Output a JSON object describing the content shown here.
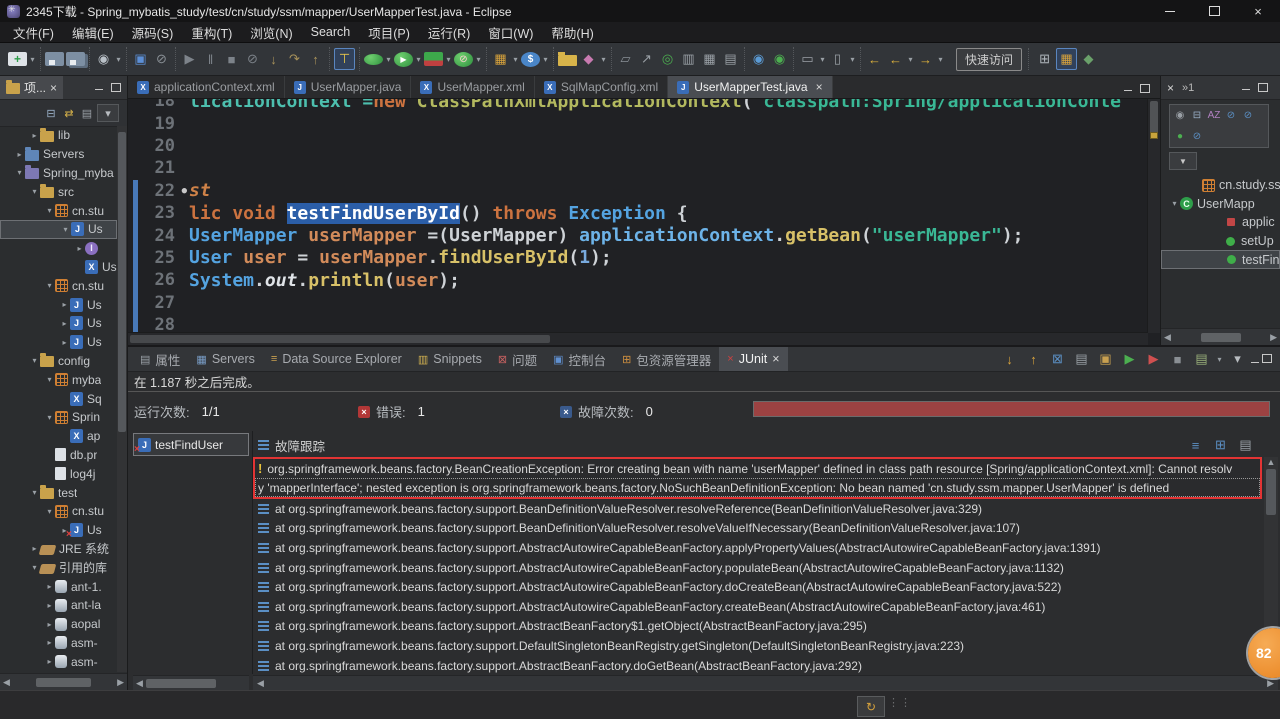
{
  "window": {
    "title": "2345下载 - Spring_mybatis_study/test/cn/study/ssm/mapper/UserMapperTest.java - Eclipse"
  },
  "menubar": [
    "文件(F)",
    "编辑(E)",
    "源码(S)",
    "重构(T)",
    "浏览(N)",
    "Search",
    "项目(P)",
    "运行(R)",
    "窗口(W)",
    "帮助(H)"
  ],
  "toolbar": {
    "quick_access_label": "快速访问",
    "groups": [
      [
        {
          "n": "new-wizard-icon",
          "k": "new",
          "dd": 1
        }
      ],
      [
        {
          "n": "save-icon",
          "k": "save"
        },
        {
          "n": "save-all-icon",
          "k": "saveall"
        }
      ],
      [
        {
          "n": "user-profile-icon",
          "g": "◉",
          "c": "#b9c0c7",
          "dd": 1
        }
      ],
      [
        {
          "n": "open-console-icon",
          "g": "▣",
          "c": "#5c8fd6"
        },
        {
          "n": "no-connection-icon",
          "g": "⊘",
          "c": "#8a9096"
        }
      ],
      [
        {
          "n": "resume-icon",
          "g": "▶",
          "c": "#7d838a"
        },
        {
          "n": "suspend-icon",
          "g": "‖",
          "c": "#7d838a"
        },
        {
          "n": "terminate-icon",
          "g": "■",
          "c": "#7d838a"
        },
        {
          "n": "disconnect-icon",
          "g": "⊘",
          "c": "#7d838a"
        },
        {
          "n": "step-into-icon",
          "g": "↓",
          "c": "#a8925a"
        },
        {
          "n": "step-over-icon",
          "g": "↷",
          "c": "#a8925a"
        },
        {
          "n": "step-return-icon",
          "g": "↑",
          "c": "#a8925a"
        }
      ],
      [
        {
          "n": "run-junit-test-icon",
          "g": "⊤",
          "c": "#e8c84a",
          "hl": 1
        }
      ],
      [
        {
          "n": "run-last-icon",
          "k": "rundot",
          "dd": 1
        },
        {
          "n": "run-icon",
          "k": "run",
          "dd": 1
        },
        {
          "n": "coverage-icon",
          "k": "cov",
          "dd": 1
        },
        {
          "n": "run-external-icon",
          "k": "runx",
          "dd": 1
        }
      ],
      [
        {
          "n": "new-javaee-icon",
          "g": "▦",
          "c": "#d8a33c",
          "dd": 1
        },
        {
          "n": "currency-tool-icon",
          "k": "dollar",
          "dd": 1
        }
      ],
      [
        {
          "n": "open-folder-icon",
          "k": "ofolder"
        },
        {
          "n": "paintbrush-icon",
          "g": "◆",
          "c": "#c87ab0",
          "dd": 1
        }
      ],
      [
        {
          "n": "flag-icon",
          "g": "▱",
          "c": "#8a9096"
        },
        {
          "n": "skew-arrow-icon",
          "g": "↗",
          "c": "#9aa0a6"
        },
        {
          "n": "new-class-icon",
          "g": "◎",
          "c": "#4CAF50"
        },
        {
          "n": "javadoc-icon",
          "g": "▥",
          "c": "#9aa0a6"
        },
        {
          "n": "table-icon",
          "g": "▦",
          "c": "#9aa0a6"
        },
        {
          "n": "grid-icon",
          "g": "▤",
          "c": "#9aa0a6"
        }
      ],
      [
        {
          "n": "web-browser-icon",
          "g": "◉",
          "c": "#5b9bd5"
        },
        {
          "n": "debug-browser-icon",
          "g": "◉",
          "c": "#4CAF50"
        }
      ],
      [
        {
          "n": "annotation-icon",
          "g": "▭",
          "c": "#9aa0a6",
          "dd": 1
        },
        {
          "n": "pin-icon",
          "g": "▯",
          "c": "#9aa0a6",
          "dd": 1
        }
      ],
      [
        {
          "n": "back-icon",
          "g": "←",
          "c": "#e0b43c"
        },
        {
          "n": "back-history-icon",
          "g": "←",
          "c": "#e0b43c",
          "dd": 1
        },
        {
          "n": "forward-icon",
          "g": "→",
          "c": "#e0b43c",
          "dd": 1
        }
      ]
    ],
    "perspectives": [
      {
        "n": "open-perspective-icon",
        "g": "⊞",
        "c": "#b0b6bc"
      },
      {
        "n": "javaee-perspective-icon",
        "g": "▦",
        "c": "#d8a33c",
        "hl": 1
      },
      {
        "n": "debug-perspective-icon",
        "g": "◆",
        "c": "#6aa06a"
      }
    ]
  },
  "explorer": {
    "tab_label": "项...",
    "toolbar": [
      {
        "n": "collapse-all-icon",
        "g": "⊟",
        "c": "#9ab0c8"
      },
      {
        "n": "link-with-editor-icon",
        "g": "⇄",
        "c": "#d8b44a"
      },
      {
        "n": "filters-icon",
        "g": "▤",
        "c": "#9aa0a6"
      },
      {
        "n": "view-menu-icon",
        "g": "▾",
        "c": "#b8bcc0",
        "box": 1
      }
    ],
    "tree": [
      {
        "lvl": 2,
        "arr": "c",
        "icon": "folder",
        "label": "lib"
      },
      {
        "lvl": 1,
        "arr": "c",
        "icon": "sfolder",
        "label": "Servers"
      },
      {
        "lvl": 1,
        "arr": "e",
        "icon": "project",
        "label": "Spring_myba"
      },
      {
        "lvl": 2,
        "arr": "e",
        "icon": "folder",
        "label": "src"
      },
      {
        "lvl": 3,
        "arr": "e",
        "icon": "pkg",
        "label": "cn.stu"
      },
      {
        "lvl": 4,
        "arr": "e",
        "icon": "java",
        "label": "Us",
        "sel": true
      },
      {
        "lvl": 5,
        "arr": "c",
        "icon": "iface",
        "label": ""
      },
      {
        "lvl": 5,
        "arr": null,
        "icon": "xml",
        "label": "Us"
      },
      {
        "lvl": 3,
        "arr": "e",
        "icon": "pkg",
        "label": "cn.stu"
      },
      {
        "lvl": 4,
        "arr": "c",
        "icon": "java",
        "label": "Us"
      },
      {
        "lvl": 4,
        "arr": "c",
        "icon": "java",
        "label": "Us"
      },
      {
        "lvl": 4,
        "arr": "c",
        "icon": "java",
        "label": "Us"
      },
      {
        "lvl": 2,
        "arr": "e",
        "icon": "folder",
        "label": "config"
      },
      {
        "lvl": 3,
        "arr": "e",
        "icon": "pkg",
        "label": "myba"
      },
      {
        "lvl": 4,
        "arr": null,
        "icon": "xml",
        "label": "Sq"
      },
      {
        "lvl": 3,
        "arr": "e",
        "icon": "pkg",
        "label": "Sprin"
      },
      {
        "lvl": 4,
        "arr": null,
        "icon": "xml",
        "label": "ap"
      },
      {
        "lvl": 3,
        "arr": null,
        "icon": "file",
        "label": "db.pr"
      },
      {
        "lvl": 3,
        "arr": null,
        "icon": "file",
        "label": "log4j"
      },
      {
        "lvl": 2,
        "arr": "e",
        "icon": "folder",
        "label": "test"
      },
      {
        "lvl": 3,
        "arr": "e",
        "icon": "pkg",
        "label": "cn.stu"
      },
      {
        "lvl": 4,
        "arr": "c",
        "icon": "testjava",
        "label": "Us"
      },
      {
        "lvl": 2,
        "arr": "c",
        "icon": "lib",
        "label": "JRE 系统"
      },
      {
        "lvl": 2,
        "arr": "e",
        "icon": "lib",
        "label": "引用的库"
      },
      {
        "lvl": 3,
        "arr": "c",
        "icon": "jar",
        "label": "ant-1."
      },
      {
        "lvl": 3,
        "arr": "c",
        "icon": "jar",
        "label": "ant-la"
      },
      {
        "lvl": 3,
        "arr": "c",
        "icon": "jar",
        "label": "aopal"
      },
      {
        "lvl": 3,
        "arr": "c",
        "icon": "jar",
        "label": "asm-"
      },
      {
        "lvl": 3,
        "arr": "c",
        "icon": "jar",
        "label": "asm-"
      }
    ]
  },
  "editor": {
    "tabs": [
      {
        "label": "applicationContext.xml",
        "icon": "X",
        "active": false
      },
      {
        "label": "UserMapper.java",
        "icon": "J",
        "active": false
      },
      {
        "label": "UserMapper.xml",
        "icon": "X",
        "active": false
      },
      {
        "label": "SqlMapConfig.xml",
        "icon": "X",
        "active": false
      },
      {
        "label": "UserMapperTest.java",
        "icon": "J",
        "active": true
      }
    ],
    "lines": [
      {
        "n": "18",
        "chg": false,
        "bullet": false,
        "seg": [
          [
            "licationContext =",
            "vteal"
          ],
          [
            "new",
            "kw"
          ],
          [
            " ",
            "pl"
          ],
          [
            "ClassPathXmlApplicationContext",
            "tyg"
          ],
          [
            "(",
            "pl"
          ],
          [
            "\"classpath:Spring/applicationConte",
            "str"
          ]
        ]
      },
      {
        "n": "19",
        "chg": false,
        "bullet": false,
        "seg": []
      },
      {
        "n": "20",
        "chg": false,
        "bullet": false,
        "seg": []
      },
      {
        "n": "21",
        "chg": false,
        "bullet": false,
        "seg": []
      },
      {
        "n": "22",
        "chg": true,
        "bullet": true,
        "seg": [
          [
            "st",
            "anno"
          ]
        ]
      },
      {
        "n": "23",
        "chg": true,
        "bullet": false,
        "seg": [
          [
            "lic void ",
            "kw"
          ],
          [
            "testFindUserById",
            "sel"
          ],
          [
            "() ",
            "pl"
          ],
          [
            "throws",
            "kw"
          ],
          [
            " ",
            "pl"
          ],
          [
            "Exception",
            "tyb"
          ],
          [
            " {",
            "pl"
          ]
        ]
      },
      {
        "n": "24",
        "chg": true,
        "bullet": false,
        "seg": [
          [
            "UserMapper",
            "tyb"
          ],
          [
            " ",
            "pl"
          ],
          [
            "userMapper",
            "vor"
          ],
          [
            " =(UserMapper) ",
            "pl"
          ],
          [
            "applicationContext",
            "vbl"
          ],
          [
            ".",
            "pl"
          ],
          [
            "getBean",
            "mth"
          ],
          [
            "(",
            "pl"
          ],
          [
            "\"userMapper\"",
            "str"
          ],
          [
            ");",
            "pl"
          ]
        ]
      },
      {
        "n": "25",
        "chg": true,
        "bullet": false,
        "seg": [
          [
            "User",
            "tyb"
          ],
          [
            " ",
            "pl"
          ],
          [
            "user",
            "vor"
          ],
          [
            " = ",
            "pl"
          ],
          [
            "userMapper",
            "vor"
          ],
          [
            ".",
            "pl"
          ],
          [
            "findUserById",
            "mth"
          ],
          [
            "(",
            "pl"
          ],
          [
            "1",
            "num"
          ],
          [
            ");",
            "pl"
          ]
        ]
      },
      {
        "n": "26",
        "chg": true,
        "bullet": false,
        "seg": [
          [
            "System",
            "tyb"
          ],
          [
            ".",
            "pl"
          ],
          [
            "out",
            "fld"
          ],
          [
            ".",
            "pl"
          ],
          [
            "println",
            "mth"
          ],
          [
            "(",
            "pl"
          ],
          [
            "user",
            "vor"
          ],
          [
            ");",
            "pl"
          ]
        ]
      },
      {
        "n": "27",
        "chg": true,
        "bullet": false,
        "seg": []
      },
      {
        "n": "28",
        "chg": true,
        "bullet": false,
        "seg": []
      }
    ]
  },
  "outline": {
    "more_indicator": "»1",
    "toolbar": [
      {
        "n": "focus-icon",
        "g": "◉",
        "c": "#9aa0a6"
      },
      {
        "n": "collapse-all-icon",
        "g": "⊟",
        "c": "#9ab0c8"
      },
      {
        "n": "sort-icon",
        "g": "AZ",
        "c": "#b080c0"
      },
      {
        "n": "hide-fields-icon",
        "g": "⊘",
        "c": "#5b8fc4"
      },
      {
        "n": "hide-static-icon",
        "g": "⊘",
        "c": "#5b8fc4"
      },
      {
        "n": "hide-nonpublic-icon",
        "g": "●",
        "c": "#4CAF50"
      },
      {
        "n": "hide-local-types-icon",
        "g": "⊘",
        "c": "#5b8fc4"
      }
    ],
    "tree": [
      {
        "lvl": 1,
        "arr": null,
        "icon": "pkgdecl",
        "label": "cn.study.ss"
      },
      {
        "lvl": 0,
        "arr": "e",
        "icon": "class",
        "label": "UserMapp"
      },
      {
        "lvl": 2,
        "arr": null,
        "icon": "field",
        "label": "applic"
      },
      {
        "lvl": 2,
        "arr": null,
        "icon": "method",
        "label": "setUp"
      },
      {
        "lvl": 2,
        "arr": null,
        "icon": "method",
        "label": "testFin",
        "sel": true
      }
    ]
  },
  "junit": {
    "tabs": [
      {
        "label": "属性",
        "g": "▤",
        "c": "#9aa0a6"
      },
      {
        "label": "Servers",
        "g": "▦",
        "c": "#7a9ec8"
      },
      {
        "label": "Data Source Explorer",
        "g": "≡",
        "c": "#c8a050"
      },
      {
        "label": "Snippets",
        "g": "▥",
        "c": "#d0b050"
      },
      {
        "label": "问题",
        "g": "⊠",
        "c": "#c46060"
      },
      {
        "label": "控制台",
        "g": "▣",
        "c": "#6090d0"
      },
      {
        "label": "包资源管理器",
        "g": "⊞",
        "c": "#d09040"
      },
      {
        "label": "JUnit",
        "g": "×",
        "c": "#d04040",
        "active": true
      }
    ],
    "view_toolbar": [
      {
        "n": "next-failed-test-icon",
        "g": "↓",
        "c": "#d8a33c"
      },
      {
        "n": "previous-failed-test-icon",
        "g": "↑",
        "c": "#d8a33c"
      },
      {
        "n": "show-failures-only-icon",
        "g": "⊠",
        "c": "#5b8fc4"
      },
      {
        "n": "show-skipped-tests-icon",
        "g": "▤",
        "c": "#9aa0a6"
      },
      {
        "n": "scroll-lock-icon",
        "g": "▣",
        "c": "#c8a050"
      },
      {
        "n": "rerun-test-icon",
        "g": "▶",
        "c": "#4CAF50"
      },
      {
        "n": "rerun-failed-first-icon",
        "g": "▶",
        "c": "#d05050"
      },
      {
        "n": "stop-junit-icon",
        "g": "■",
        "c": "#8a8f94"
      },
      {
        "n": "test-history-icon",
        "g": "▤",
        "c": "#9ab07a",
        "dd": 1
      },
      {
        "n": "view-menu-icon",
        "g": "▾",
        "c": "#b8bcc0"
      }
    ],
    "finished_text": "在 1.187 秒之后完成。",
    "runs_label": "运行次数:",
    "runs_value": "1/1",
    "errors_label": "错误:",
    "errors_value": "1",
    "failures_label": "故障次数:",
    "failures_value": "0",
    "test_item_label": "testFindUser",
    "trace_header": "故障跟踪",
    "trace_header_icons": [
      {
        "n": "filter-stack-icon",
        "g": "≡",
        "c": "#5b8fc4"
      },
      {
        "n": "compare-result-icon",
        "g": "⊞",
        "c": "#5b8fc4"
      },
      {
        "n": "layout-icon",
        "g": "▤",
        "c": "#9aa0a6"
      }
    ],
    "trace_error": [
      "org.springframework.beans.factory.BeanCreationException: Error creating bean with name 'userMapper' defined in class path resource [Spring/applicationContext.xml]: Cannot resolv",
      "y 'mapperInterface'; nested exception is org.springframework.beans.factory.NoSuchBeanDefinitionException: No bean named 'cn.study.ssm.mapper.UserMapper' is defined"
    ],
    "trace_lines": [
      "at org.springframework.beans.factory.support.BeanDefinitionValueResolver.resolveReference(BeanDefinitionValueResolver.java:329)",
      "at org.springframework.beans.factory.support.BeanDefinitionValueResolver.resolveValueIfNecessary(BeanDefinitionValueResolver.java:107)",
      "at org.springframework.beans.factory.support.AbstractAutowireCapableBeanFactory.applyPropertyValues(AbstractAutowireCapableBeanFactory.java:1391)",
      "at org.springframework.beans.factory.support.AbstractAutowireCapableBeanFactory.populateBean(AbstractAutowireCapableBeanFactory.java:1132)",
      "at org.springframework.beans.factory.support.AbstractAutowireCapableBeanFactory.doCreateBean(AbstractAutowireCapableBeanFactory.java:522)",
      "at org.springframework.beans.factory.support.AbstractAutowireCapableBeanFactory.createBean(AbstractAutowireCapableBeanFactory.java:461)",
      "at org.springframework.beans.factory.support.AbstractBeanFactory$1.getObject(AbstractBeanFactory.java:295)",
      "at org.springframework.beans.factory.support.DefaultSingletonBeanRegistry.getSingleton(DefaultSingletonBeanRegistry.java:223)",
      "at org.springframework.beans.factory.support.AbstractBeanFactory.doGetBean(AbstractBeanFactory.java:292)"
    ]
  },
  "badge": {
    "value": "82"
  },
  "colors": {
    "accent_red": "#e23434",
    "progress_red": "#9c4242",
    "selection_blue": "#2b5ea8"
  }
}
